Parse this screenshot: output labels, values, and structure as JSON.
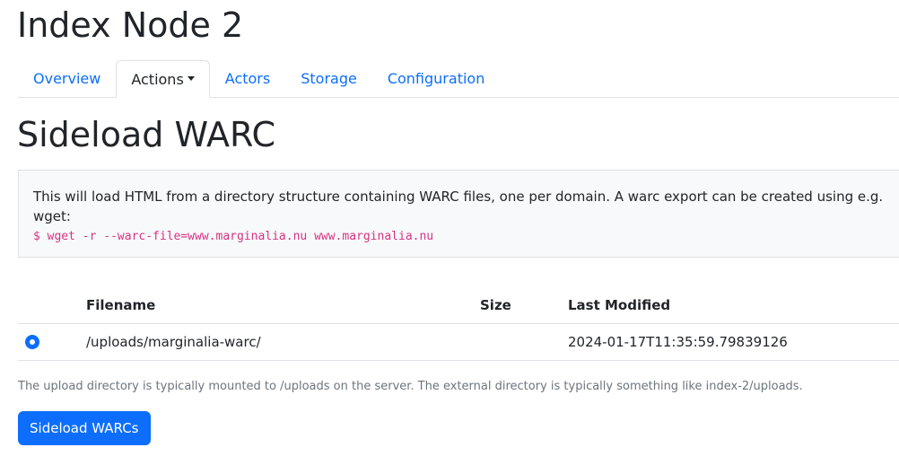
{
  "page": {
    "title": "Index Node 2"
  },
  "nav": {
    "tabs": [
      {
        "label": "Overview",
        "active": false
      },
      {
        "label": "Actions",
        "active": true,
        "has_dropdown": true
      },
      {
        "label": "Actors",
        "active": false
      },
      {
        "label": "Storage",
        "active": false
      },
      {
        "label": "Configuration",
        "active": false
      }
    ]
  },
  "section": {
    "title": "Sideload WARC",
    "description": "This will load HTML from a directory structure containing WARC files, one per domain. A warc export can be created using e.g. wget:",
    "command": "$ wget -r --warc-file=www.marginalia.nu www.marginalia.nu"
  },
  "table": {
    "headers": {
      "filename": "Filename",
      "size": "Size",
      "last_modified": "Last Modified"
    },
    "rows": [
      {
        "selected": true,
        "filename": "/uploads/marginalia-warc/",
        "size": "",
        "last_modified": "2024-01-17T11:35:59.79839126"
      }
    ]
  },
  "help_text": "The upload directory is typically mounted to /uploads on the server. The external directory is typically something like index-2/uploads.",
  "actions": {
    "submit_label": "Sideload WARCs"
  },
  "colors": {
    "primary": "#0d6efd",
    "code": "#d63384",
    "muted": "#6c757d",
    "panel_bg": "#f8f9fa",
    "border": "#dee2e6"
  }
}
